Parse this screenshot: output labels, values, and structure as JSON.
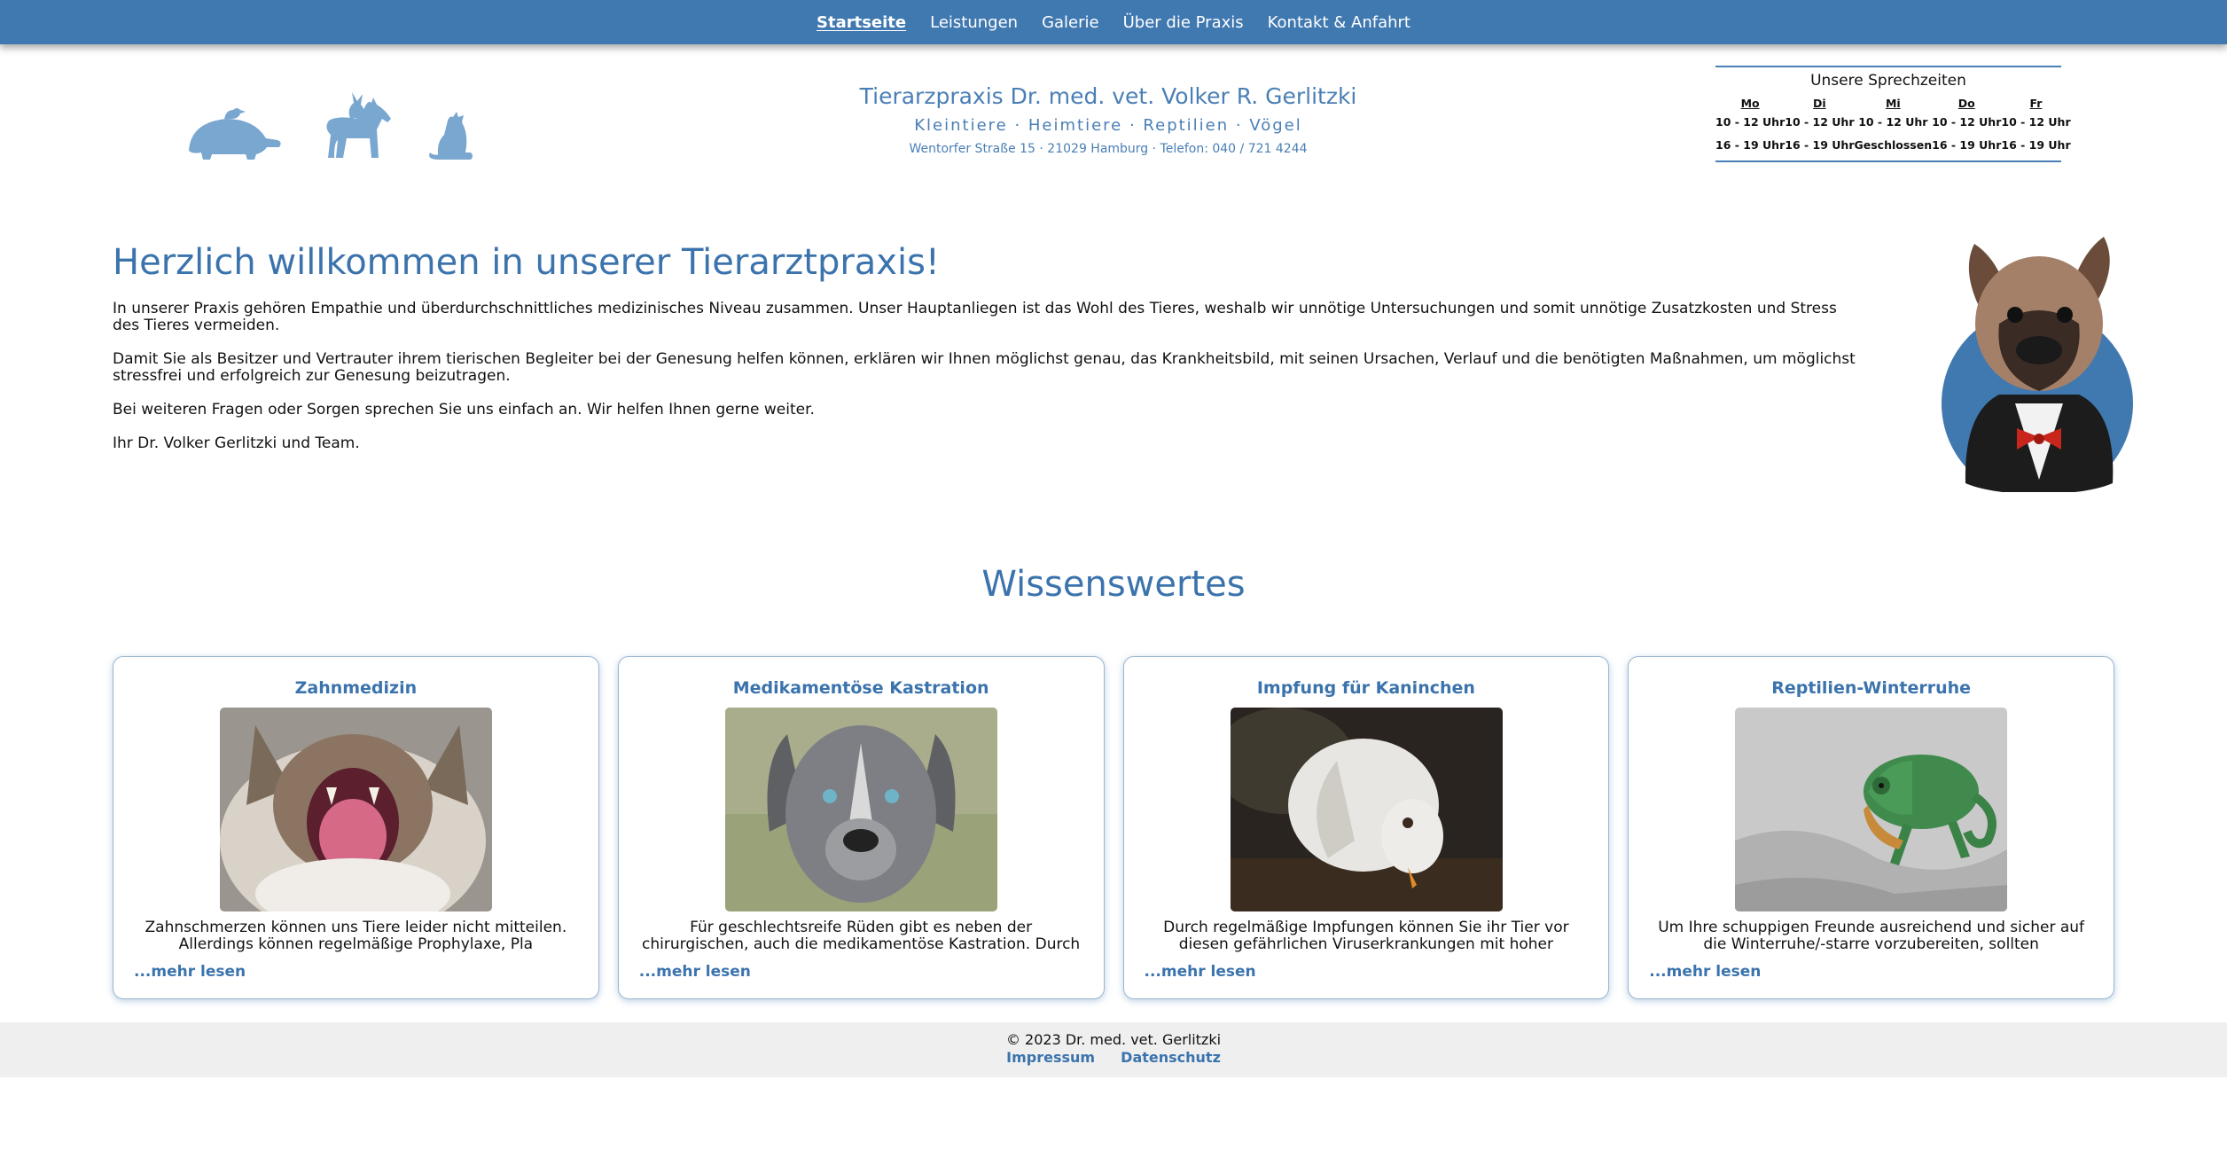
{
  "nav": {
    "items": [
      "Startseite",
      "Leistungen",
      "Galerie",
      "Über die Praxis",
      "Kontakt & Anfahrt"
    ],
    "active": "Startseite"
  },
  "header": {
    "title": "Tierarzpraxis Dr. med. vet. Volker R. Gerlitzki",
    "subtitle": "Kleintiere · Heimtiere · Reptilien · Vögel",
    "address": "Wentorfer Straße 15 · 21029 Hamburg · Telefon: 040 / 721 4244",
    "logo_icons": [
      "turtle-with-bird-icon",
      "horse-with-rabbit-icon",
      "cat-icon"
    ],
    "logo_color": "#7aa7d0"
  },
  "hours": {
    "title": "Unsere Sprechzeiten",
    "days": [
      "Mo",
      "Di",
      "Mi",
      "Do",
      "Fr"
    ],
    "morning": [
      "10 - 12 Uhr",
      "10 - 12 Uhr",
      "10 - 12 Uhr",
      "10 - 12 Uhr",
      "10 - 12 Uhr"
    ],
    "afternoon": [
      "16 - 19 Uhr",
      "16 - 19 Uhr",
      "Geschlossen",
      "16 - 19 Uhr",
      "16 - 19 Uhr"
    ]
  },
  "welcome": {
    "heading": "Herzlich willkommen in unserer Tierarztpraxis!",
    "paragraphs": [
      "In unserer Praxis gehören Empathie und überdurchschnittliches medizinisches Niveau zusammen. Unser Hauptanliegen ist das Wohl des Tieres, weshalb wir unnötige Untersuchungen und somit unnötige Zusatzkosten und Stress des Tieres vermeiden.",
      "Damit Sie als Besitzer und Vertrauter ihrem tierischen Begleiter bei der Genesung helfen können, erklären wir Ihnen möglichst genau, das Krankheitsbild, mit seinen Ursachen, Verlauf und die benötigten Maßnahmen, um möglichst stressfrei und erfolgreich zur Genesung beizutragen.",
      "Bei weiteren Fragen oder Sorgen sprechen Sie uns einfach an. Wir helfen Ihnen gerne weiter.",
      "Ihr Dr. Volker Gerlitzki und Team."
    ]
  },
  "knowledge": {
    "title": "Wissenswertes",
    "cards": [
      {
        "title": "Zahnmedizin",
        "text": "Zahnschmerzen können uns Tiere leider nicht mitteilen. Allerdings können regelmäßige Prophylaxe, Pla",
        "more": "...mehr lesen"
      },
      {
        "title": "Medikamentöse Kastration",
        "text": "Für geschlechtsreife Rüden gibt es neben der chirurgischen, auch die medikamentöse Kastration. Durch",
        "more": "...mehr lesen"
      },
      {
        "title": "Impfung für Kaninchen",
        "text": "Durch regelmäßige Impfungen können Sie ihr Tier vor diesen gefährlichen Viruserkrankungen mit hoher",
        "more": "...mehr lesen"
      },
      {
        "title": "Reptilien-Winterruhe",
        "text": "Um Ihre schuppigen Freunde ausreichend und sicher auf die Winterruhe/-starre vorzubereiten, sollten",
        "more": "...mehr lesen"
      }
    ]
  },
  "footer": {
    "copyright": "© 2023 Dr. med. vet. Gerlitzki",
    "links": [
      "Impressum",
      "Datenschutz"
    ]
  },
  "colors": {
    "primary": "#4078b0",
    "heading": "#3b73ad",
    "footer_bg": "#efefef"
  }
}
